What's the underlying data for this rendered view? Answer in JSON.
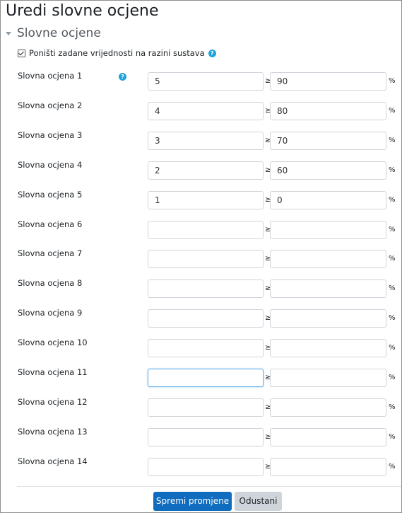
{
  "page": {
    "title": "Uredi slovne ocjene"
  },
  "section": {
    "title": "Slovne ocjene",
    "expanded": true
  },
  "override": {
    "label": "Poništi zadane vrijednosti na razini sustava",
    "checked": true
  },
  "symbols": {
    "ge": "≥",
    "percent": "%",
    "help": "?"
  },
  "rows": [
    {
      "label": "Slovna ocjena 1",
      "letter": "5",
      "boundary": "90"
    },
    {
      "label": "Slovna ocjena 2",
      "letter": "4",
      "boundary": "80"
    },
    {
      "label": "Slovna ocjena 3",
      "letter": "3",
      "boundary": "70"
    },
    {
      "label": "Slovna ocjena 4",
      "letter": "2",
      "boundary": "60"
    },
    {
      "label": "Slovna ocjena 5",
      "letter": "1",
      "boundary": "0"
    },
    {
      "label": "Slovna ocjena 6",
      "letter": "",
      "boundary": ""
    },
    {
      "label": "Slovna ocjena 7",
      "letter": "",
      "boundary": ""
    },
    {
      "label": "Slovna ocjena 8",
      "letter": "",
      "boundary": ""
    },
    {
      "label": "Slovna ocjena 9",
      "letter": "",
      "boundary": ""
    },
    {
      "label": "Slovna ocjena 10",
      "letter": "",
      "boundary": ""
    },
    {
      "label": "Slovna ocjena 11",
      "letter": "",
      "boundary": "",
      "focused": true
    },
    {
      "label": "Slovna ocjena 12",
      "letter": "",
      "boundary": ""
    },
    {
      "label": "Slovna ocjena 13",
      "letter": "",
      "boundary": ""
    },
    {
      "label": "Slovna ocjena 14",
      "letter": "",
      "boundary": ""
    }
  ],
  "buttons": {
    "save": "Spremi promjene",
    "cancel": "Odustani"
  },
  "colors": {
    "primary": "#0f6cbf",
    "help": "#1fa3db",
    "secondary": "#ced4da"
  }
}
